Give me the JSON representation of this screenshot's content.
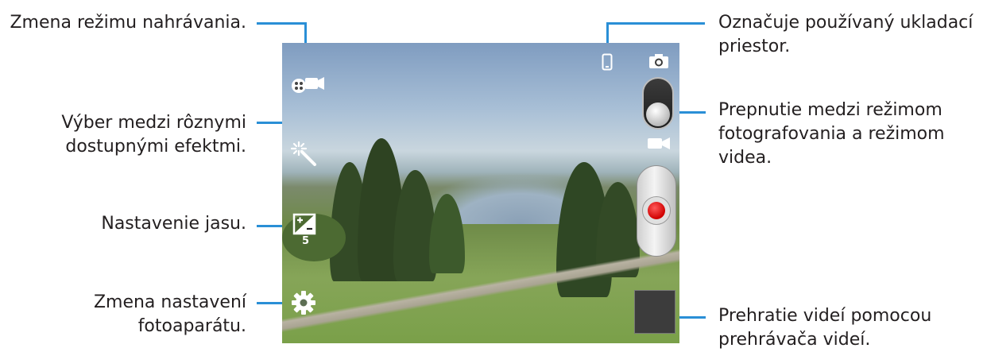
{
  "labels": {
    "recording_mode": "Zmena režimu nahrávania.",
    "effects_line1": "Výber medzi rôznymi",
    "effects_line2": "dostupnými efektmi.",
    "brightness": "Nastavenie jasu.",
    "settings_line1": "Zmena nastavení",
    "settings_line2": "fotoaparátu.",
    "storage_line1": "Označuje používaný ukladací",
    "storage_line2": "priestor.",
    "mode_switch_line1": "Prepnutie medzi režimom",
    "mode_switch_line2": "fotografovania a režimom",
    "mode_switch_line3": "videa.",
    "playback_line1": "Prehratie videí pomocou",
    "playback_line2": "prehrávača videí."
  },
  "camera": {
    "exposure_value": "5",
    "toggle_mode": "video"
  },
  "colors": {
    "callout_line": "#2a8fd6",
    "record_button": "#d00000"
  },
  "icons": {
    "recording_mode": "recording-mode-icon",
    "effects": "effects-wand-icon",
    "brightness": "exposure-icon",
    "settings": "gear-icon",
    "storage": "phone-storage-icon",
    "photo_mode": "camera-icon",
    "video_mode": "video-camera-icon"
  }
}
